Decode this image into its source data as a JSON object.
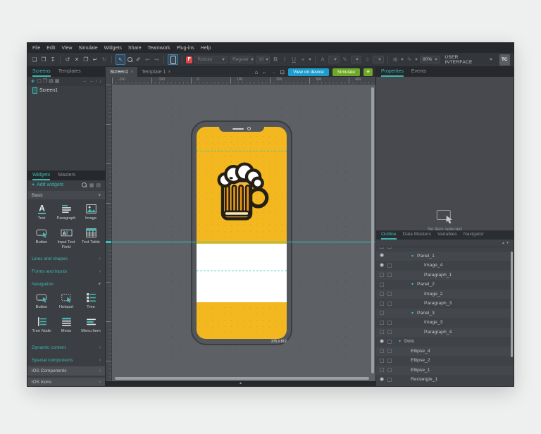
{
  "colors": {
    "accent_teal": "#3db6af",
    "screen_yellow": "#f3b71f",
    "button_blue": "#1d9ccd",
    "button_green": "#6fa726",
    "font_badge_red": "#e04444",
    "guide_teal": "#2ec4bb"
  },
  "menu": {
    "items": [
      "File",
      "Edit",
      "View",
      "Simulate",
      "Widgets",
      "Share",
      "Teamwork",
      "Plug-ins",
      "Help"
    ]
  },
  "toolbar": {
    "file_group": [
      {
        "n": "new-file-icon",
        "g": "❏",
        "cls": ""
      },
      {
        "n": "open-icon",
        "g": "❒",
        "cls": ""
      },
      {
        "n": "publish-icon",
        "g": "↧",
        "cls": ""
      }
    ],
    "edit_group": [
      {
        "n": "undo-icon",
        "g": "↺",
        "cls": ""
      },
      {
        "n": "delete-icon",
        "g": "✕",
        "cls": ""
      },
      {
        "n": "copy-icon",
        "g": "❐",
        "cls": ""
      },
      {
        "n": "paste-icon",
        "g": "↵",
        "cls": ""
      },
      {
        "n": "redo-icon",
        "g": "↻",
        "cls": "dim"
      }
    ],
    "select_tool_glyph": "↖",
    "hand_group": [
      {
        "n": "eyedropper-icon",
        "g": "✐",
        "cls": ""
      },
      {
        "n": "rotate-left-icon",
        "g": "↩",
        "cls": "dim"
      },
      {
        "n": "rotate-right-icon",
        "g": "↪",
        "cls": "dim"
      }
    ],
    "font_badge": "F",
    "font_family": "Roboto",
    "font_style": "Regular",
    "font_size": "10",
    "bold": "B",
    "italic": "I",
    "underline": "U",
    "align_glyph": "≡",
    "font_color_glyph": "A",
    "border_color_glyph": "✎",
    "fill_color_glyph": "◊",
    "shapes_glyph": "⊞",
    "pen_glyph": "✎",
    "zoom": "80%",
    "mode": "USER INTERFACE",
    "avatar": "TC"
  },
  "screens_panel": {
    "tabs": [
      {
        "label": "Screens",
        "cls": "active"
      },
      {
        "label": "Templates",
        "cls": ""
      }
    ],
    "plus": "+",
    "tools": [
      {
        "n": "new-screen-icon",
        "g": "▢"
      },
      {
        "n": "new-folder-icon",
        "g": "❒"
      },
      {
        "n": "duplicate-icon",
        "g": "▤"
      },
      {
        "n": "grid-view-icon",
        "g": "▦"
      }
    ],
    "arrows": [
      {
        "n": "move-left-icon",
        "g": "←"
      },
      {
        "n": "move-right-icon",
        "g": "→"
      },
      {
        "n": "move-up-icon",
        "g": "↑"
      },
      {
        "n": "move-down-icon",
        "g": "↓"
      }
    ],
    "items": [
      {
        "label": "Screen1"
      }
    ]
  },
  "widgets_panel": {
    "tabs": [
      {
        "label": "Widgets",
        "cls": "active"
      },
      {
        "label": "Masters",
        "cls": ""
      }
    ],
    "plus": "+",
    "add_label": "Add widgets",
    "head_icons": [
      {
        "n": "grid-layout-icon",
        "g": "▦"
      },
      {
        "n": "list-layout-icon",
        "g": "▤"
      }
    ],
    "basic": {
      "label": "Basic",
      "chev": "▾"
    },
    "basic_items": [
      {
        "label": "Text",
        "icon": "#w-text"
      },
      {
        "label": "Paragraph",
        "icon": "#w-paragraph"
      },
      {
        "label": "Image",
        "icon": "#w-image"
      },
      {
        "label": "Button",
        "icon": "#w-button"
      },
      {
        "label": "Input Text Field",
        "icon": "#w-input"
      },
      {
        "label": "Text Table",
        "icon": "#w-table"
      }
    ],
    "sections1": [
      {
        "label": "Lines and shapes",
        "chev": "›"
      },
      {
        "label": "Forms and inputs",
        "chev": "›"
      }
    ],
    "navigation": {
      "label": "Navigation",
      "chev": "▾"
    },
    "nav_items": [
      {
        "label": "Button",
        "icon": "#w-button"
      },
      {
        "label": "Hotspot",
        "icon": "#w-hotspot"
      },
      {
        "label": "Tree",
        "icon": "#w-tree"
      },
      {
        "label": "Tree Node",
        "icon": "#w-treenode"
      },
      {
        "label": "Menu",
        "icon": "#w-menu"
      },
      {
        "label": "Menu Item",
        "icon": "#w-menuitem"
      }
    ],
    "sections2": [
      {
        "label": "Dynamic content",
        "chev": "›"
      },
      {
        "label": "Special components",
        "chev": "›"
      }
    ],
    "ios_sections": [
      {
        "label": "iOS Components",
        "chev": "›"
      },
      {
        "label": "iOS Icons",
        "chev": "›"
      }
    ]
  },
  "canvas": {
    "tabs": [
      {
        "label": "Screen1",
        "cls": "active"
      },
      {
        "label": "Template 1",
        "cls": ""
      }
    ],
    "close_glyph": "×",
    "nav": [
      {
        "n": "home-icon",
        "g": "⌂",
        "cls": ""
      },
      {
        "n": "back-icon",
        "g": "←",
        "cls": ""
      },
      {
        "n": "forward-icon",
        "g": "→",
        "cls": "dim"
      },
      {
        "n": "fit-screen-icon",
        "g": "⊡",
        "cls": ""
      }
    ],
    "view_on_device": "View on device",
    "simulate": "Simulate",
    "gear_glyph": "✳",
    "ruler_labels": [
      "-200",
      "-100",
      "0",
      "100",
      "200",
      "300",
      "400"
    ],
    "collapse_glyph": "▴",
    "phone": {
      "size_label": "375 x 812"
    }
  },
  "properties_panel": {
    "tabs": [
      {
        "label": "Properties",
        "cls": "active"
      },
      {
        "label": "Events",
        "cls": ""
      }
    ],
    "empty_text": "No item selected"
  },
  "outline_panel": {
    "tabs": [
      {
        "label": "Outline",
        "cls": "active"
      },
      {
        "label": "Data Masters",
        "cls": ""
      },
      {
        "label": "Variables",
        "cls": ""
      },
      {
        "label": "Navigator",
        "cls": ""
      }
    ],
    "up_glyph": "▴",
    "down_glyph": "▾",
    "rows": [
      {
        "name": "",
        "c1": "box",
        "c2": "box",
        "chev": "",
        "ind": "i3",
        "cls": "partial"
      },
      {
        "name": "Panel_1",
        "c1": "eye",
        "c2": "",
        "chev": "▾",
        "ind": "i2",
        "cls": ""
      },
      {
        "name": "Image_4",
        "c1": "eye",
        "c2": "box",
        "chev": "",
        "ind": "i3",
        "cls": ""
      },
      {
        "name": "Paragraph_1",
        "c1": "box",
        "c2": "box",
        "chev": "",
        "ind": "i3",
        "cls": ""
      },
      {
        "name": "Panel_2",
        "c1": "box",
        "c2": "",
        "chev": "▾",
        "ind": "i2",
        "cls": ""
      },
      {
        "name": "Image_2",
        "c1": "box",
        "c2": "box",
        "chev": "",
        "ind": "i3",
        "cls": ""
      },
      {
        "name": "Paragraph_3",
        "c1": "box",
        "c2": "box",
        "chev": "",
        "ind": "i3",
        "cls": ""
      },
      {
        "name": "Panel_3",
        "c1": "box",
        "c2": "",
        "chev": "▾",
        "ind": "i2",
        "cls": ""
      },
      {
        "name": "Image_3",
        "c1": "box",
        "c2": "box",
        "chev": "",
        "ind": "i3",
        "cls": ""
      },
      {
        "name": "Paragraph_4",
        "c1": "box",
        "c2": "box",
        "chev": "",
        "ind": "i3",
        "cls": ""
      },
      {
        "name": "Dots",
        "c1": "eye",
        "c2": "box",
        "chev": "▾",
        "ind": "i0",
        "cls": ""
      },
      {
        "name": "Ellipse_4",
        "c1": "box",
        "c2": "box",
        "chev": "",
        "ind": "i1",
        "cls": ""
      },
      {
        "name": "Ellipse_2",
        "c1": "box",
        "c2": "box",
        "chev": "",
        "ind": "i1",
        "cls": ""
      },
      {
        "name": "Ellipse_1",
        "c1": "box",
        "c2": "box",
        "chev": "",
        "ind": "i1",
        "cls": ""
      },
      {
        "name": "Rectangle_1",
        "c1": "eye",
        "c2": "box",
        "chev": "",
        "ind": "i1",
        "cls": ""
      }
    ]
  }
}
